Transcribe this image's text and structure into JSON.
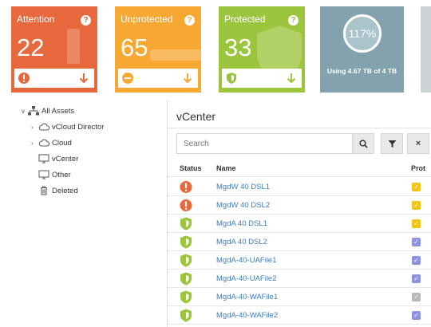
{
  "tiles": {
    "attention": {
      "title": "Attention",
      "count": "22",
      "help": "?",
      "color": "#e6683c"
    },
    "unprotected": {
      "title": "Unprotected",
      "count": "65",
      "help": "?",
      "color": "#f7a833"
    },
    "protected": {
      "title": "Protected",
      "count": "33",
      "help": "?",
      "color": "#9bc53c"
    },
    "storage": {
      "percent": "117%",
      "usage": "Using 4.67 TB of 4 TB",
      "color": "#82a3ad"
    }
  },
  "tree": {
    "root": "All Assets",
    "items": [
      {
        "label": "vCloud Director",
        "icon": "cloud-icon"
      },
      {
        "label": "Cloud",
        "icon": "cloud-icon"
      },
      {
        "label": "vCenter",
        "icon": "monitor-icon",
        "selected": true
      },
      {
        "label": "Other",
        "icon": "monitor-icon"
      },
      {
        "label": "Deleted",
        "icon": "trash-icon"
      }
    ]
  },
  "main": {
    "title": "vCenter",
    "search_placeholder": "Search",
    "columns": {
      "status": "Status",
      "name": "Name",
      "protection": "Prot"
    },
    "rows": [
      {
        "status": "attention",
        "name": "MgdW 40 DSL1",
        "check_color": "#f2c418"
      },
      {
        "status": "attention",
        "name": "MgdW 40 DSL2",
        "check_color": "#f2c418"
      },
      {
        "status": "protected",
        "name": "MgdA 40 DSL1",
        "check_color": "#f2c418"
      },
      {
        "status": "protected",
        "name": "MgdA 40 DSL2",
        "check_color": "#8e93e0"
      },
      {
        "status": "protected",
        "name": "MgdA-40-UAFile1",
        "check_color": "#8e93e0"
      },
      {
        "status": "protected",
        "name": "MgdA-40-UAFile2",
        "check_color": "#8e93e0"
      },
      {
        "status": "protected",
        "name": "MgdA-40-WAFile1",
        "check_color": "#b8b8b8"
      },
      {
        "status": "protected",
        "name": "MgdA-40-WAFile2",
        "check_color": "#8e93e0"
      }
    ]
  }
}
